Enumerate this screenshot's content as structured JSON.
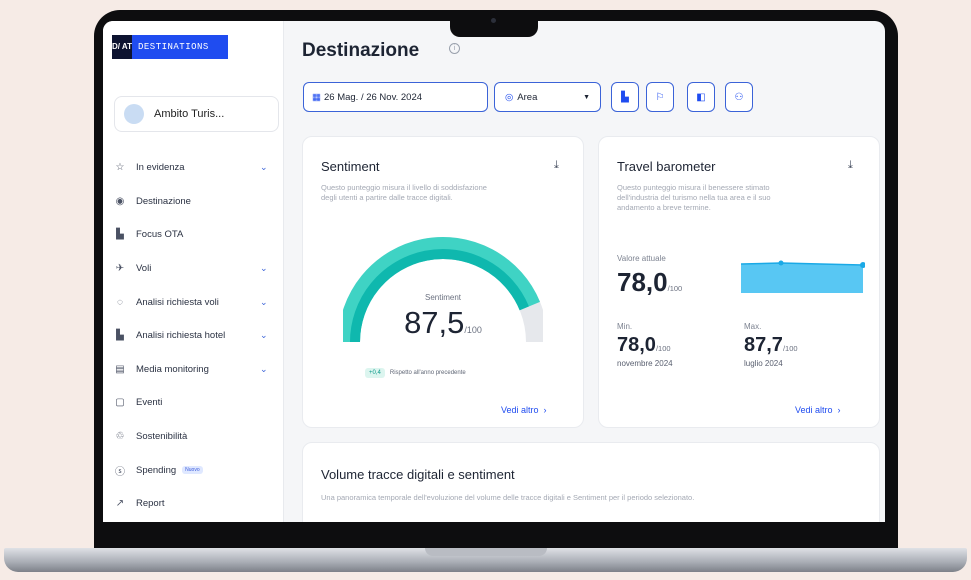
{
  "logo": {
    "mark": "D/ AT",
    "text": "DESTINATIONS"
  },
  "sidebar": {
    "scope_label": "Ambito Turis...",
    "items": [
      {
        "label": "In evidenza",
        "icon": "☆",
        "chevron": true
      },
      {
        "label": "Destinazione",
        "icon": "◉",
        "chevron": false
      },
      {
        "label": "Focus OTA",
        "icon": "▙",
        "chevron": false
      },
      {
        "label": "Voli",
        "icon": "✈",
        "chevron": true
      },
      {
        "label": "Analisi richiesta voli",
        "icon": "◌",
        "chevron": true
      },
      {
        "label": "Analisi richiesta hotel",
        "icon": "▙",
        "chevron": true
      },
      {
        "label": "Media monitoring",
        "icon": "▤",
        "chevron": true
      },
      {
        "label": "Eventi",
        "icon": "▢",
        "chevron": false
      },
      {
        "label": "Sostenibilità",
        "icon": "♲",
        "chevron": false
      },
      {
        "label": "Spending",
        "icon": "ⓢ",
        "chevron": false,
        "badge": "Nuovo"
      },
      {
        "label": "Report",
        "icon": "↗",
        "chevron": false
      }
    ],
    "chevron_glyph": "⌄"
  },
  "header": {
    "title": "Destinazione",
    "info_icon": "i"
  },
  "filters": {
    "date_icon": "▦",
    "date_range": "26 Mag. / 26 Nov. 2024",
    "area_icon": "◎",
    "area_label": "Area",
    "area_caret": "▼",
    "icon_buttons": [
      "▙",
      "⚐",
      "◧",
      "⚇"
    ]
  },
  "sentiment_card": {
    "title": "Sentiment",
    "download_icon": "⤓",
    "description_lines": [
      "Questo punteggio misura il livello di soddisfazione",
      "degli utenti a partire dalle tracce digitali."
    ],
    "gauge_label": "Sentiment",
    "value": "87,5",
    "value_fraction": 0.875,
    "unit": "/100",
    "delta": "+0,4",
    "delta_text": "Rispetto all'anno precedente",
    "more_link": "Vedi altro",
    "more_icon": "›",
    "colors": {
      "arc_light": "#3fd3c4",
      "arc_dark": "#0fb8ae",
      "track": "#e6e8ec"
    }
  },
  "barometer_card": {
    "title": "Travel barometer",
    "download_icon": "⤓",
    "description_lines": [
      "Questo punteggio misura il benessere stimato",
      "dell'industria del turismo nella tua area e il suo",
      "andamento a breve termine."
    ],
    "current_label": "Valore attuale",
    "current_value": "78,0",
    "unit": "/100",
    "min_label": "Min.",
    "min_value": "78,0",
    "min_date": "novembre 2024",
    "max_label": "Max.",
    "max_value": "87,7",
    "max_date": "luglio 2024",
    "more_link": "Vedi altro",
    "more_icon": "›",
    "colors": {
      "area": "#58c7f3",
      "line": "#1aa9e6"
    }
  },
  "volume_card": {
    "title": "Volume tracce digitali e sentiment",
    "description": "Una panoramica temporale dell'evoluzione del volume delle tracce digitali e Sentiment per il periodo selezionato."
  },
  "colors": {
    "accent": "#1f4cf0",
    "teal": "#0fb8ae"
  }
}
